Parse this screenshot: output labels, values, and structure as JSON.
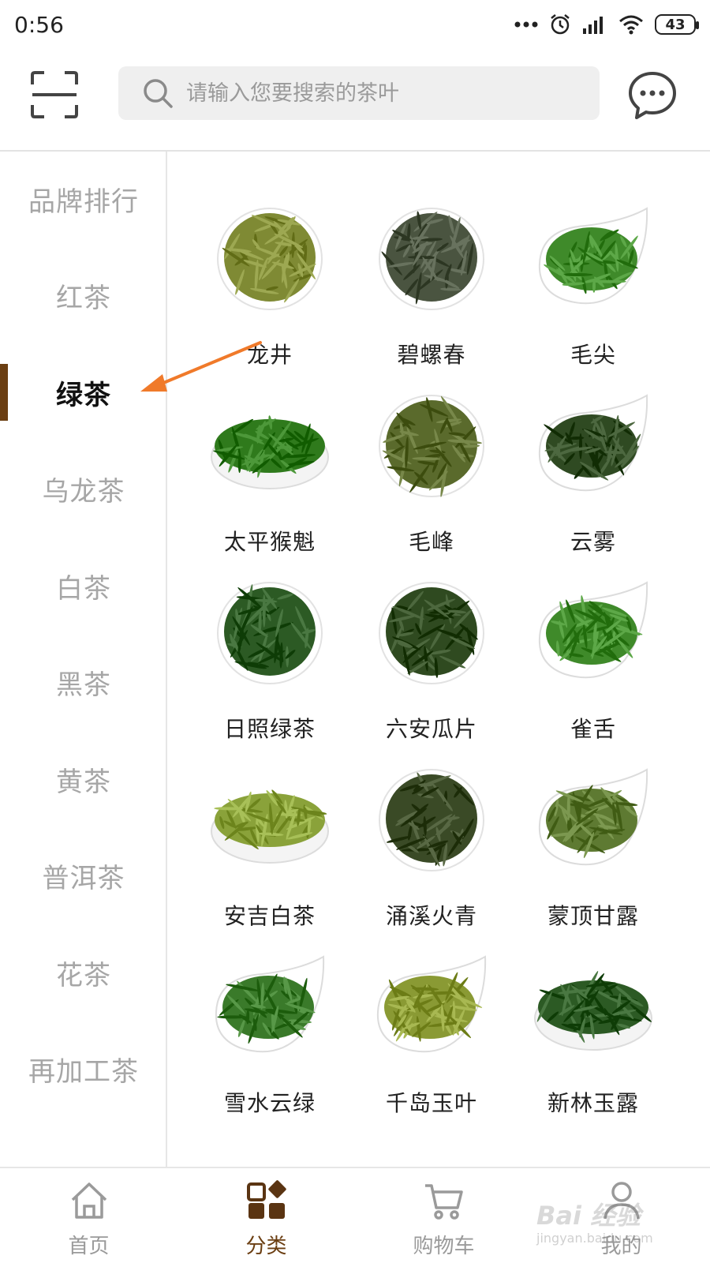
{
  "status_bar": {
    "time": "0:56",
    "battery": "43"
  },
  "header": {
    "search_placeholder": "请输入您要搜索的茶叶"
  },
  "sidebar": {
    "items": [
      {
        "label": "品牌排行"
      },
      {
        "label": "红茶"
      },
      {
        "label": "绿茶",
        "active": true
      },
      {
        "label": "乌龙茶"
      },
      {
        "label": "白茶"
      },
      {
        "label": "黑茶"
      },
      {
        "label": "黄茶"
      },
      {
        "label": "普洱茶"
      },
      {
        "label": "花茶"
      },
      {
        "label": "再加工茶"
      }
    ]
  },
  "teas": [
    {
      "name": "龙井",
      "leaf_color": "#7f8a34",
      "bowl": "round"
    },
    {
      "name": "碧螺春",
      "leaf_color": "#4a5440",
      "bowl": "round"
    },
    {
      "name": "毛尖",
      "leaf_color": "#3f8a2a",
      "bowl": "scoop"
    },
    {
      "name": "太平猴魁",
      "leaf_color": "#2f7a1c",
      "bowl": "flat"
    },
    {
      "name": "毛峰",
      "leaf_color": "#5a6a2c",
      "bowl": "round"
    },
    {
      "name": "云雾",
      "leaf_color": "#2f4a22",
      "bowl": "scoop"
    },
    {
      "name": "日照绿茶",
      "leaf_color": "#2c5a24",
      "bowl": "round"
    },
    {
      "name": "六安瓜片",
      "leaf_color": "#2f4a20",
      "bowl": "round"
    },
    {
      "name": "雀舌",
      "leaf_color": "#3f8a2a",
      "bowl": "scoop"
    },
    {
      "name": "安吉白茶",
      "leaf_color": "#8aa23a",
      "bowl": "flat"
    },
    {
      "name": "涌溪火青",
      "leaf_color": "#3a4a26",
      "bowl": "round"
    },
    {
      "name": "蒙顶甘露",
      "leaf_color": "#5e7a32",
      "bowl": "scoop"
    },
    {
      "name": "雪水云绿",
      "leaf_color": "#3a7a2a",
      "bowl": "scoop"
    },
    {
      "name": "千岛玉叶",
      "leaf_color": "#8a9a34",
      "bowl": "scoop"
    },
    {
      "name": "新林玉露",
      "leaf_color": "#2c5a24",
      "bowl": "flat"
    }
  ],
  "bottom_nav": [
    {
      "label": "首页",
      "icon": "home-icon"
    },
    {
      "label": "分类",
      "icon": "category-icon",
      "active": true
    },
    {
      "label": "购物车",
      "icon": "cart-icon"
    },
    {
      "label": "我的",
      "icon": "profile-icon"
    }
  ],
  "colors": {
    "accent": "#6b3e12",
    "annotation": "#f07a2a",
    "inactive": "#a6a6a6"
  },
  "watermark": {
    "main": "Bai 经验",
    "sub": "jingyan.baidu.com"
  }
}
